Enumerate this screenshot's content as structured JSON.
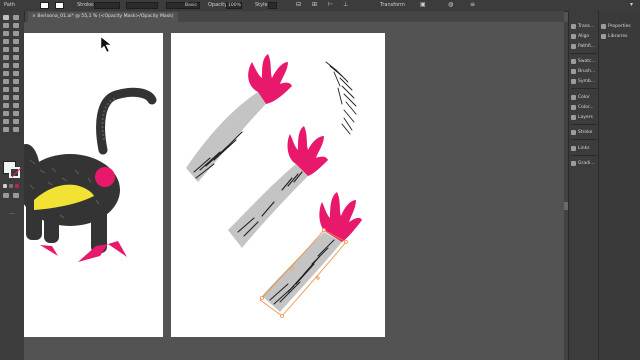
{
  "control_bar": {
    "selection_label": "Path",
    "stroke_label": "Stroke:",
    "brush_label": "Basic",
    "opacity_label": "Opacity:",
    "opacity_value": "100%",
    "style_label": "Style:",
    "transform_label": "Transform"
  },
  "document": {
    "tab_title": "Berloona_01.ai* @ 55,1 % (<Opacity Mask>/Opacity Mask)"
  },
  "panels_mid": [
    {
      "label": "Trans...",
      "icon": "transform-icon"
    },
    {
      "label": "Align",
      "icon": "align-icon"
    },
    {
      "label": "Pathfi...",
      "icon": "pathfinder-icon"
    },
    {
      "label": "Swatc...",
      "icon": "swatches-icon"
    },
    {
      "label": "Brush...",
      "icon": "brushes-icon"
    },
    {
      "label": "Symb...",
      "icon": "symbols-icon"
    },
    {
      "label": "Color",
      "icon": "color-icon"
    },
    {
      "label": "Color...",
      "icon": "color-guide-icon"
    },
    {
      "label": "Layers",
      "icon": "layers-icon"
    },
    {
      "label": "Stroke",
      "icon": "stroke-icon"
    },
    {
      "label": "Links",
      "icon": "links-icon"
    },
    {
      "label": "Gradi...",
      "icon": "gradient-icon"
    }
  ],
  "panels_right": [
    {
      "label": "Properties",
      "icon": "properties-icon"
    },
    {
      "label": "Libraries",
      "icon": "libraries-icon"
    }
  ],
  "colors": {
    "magenta": "#e8196b",
    "yellow": "#f2e234",
    "arm_gray": "#c4c4c4",
    "fur": "#333333",
    "selection": "#f08a36"
  }
}
